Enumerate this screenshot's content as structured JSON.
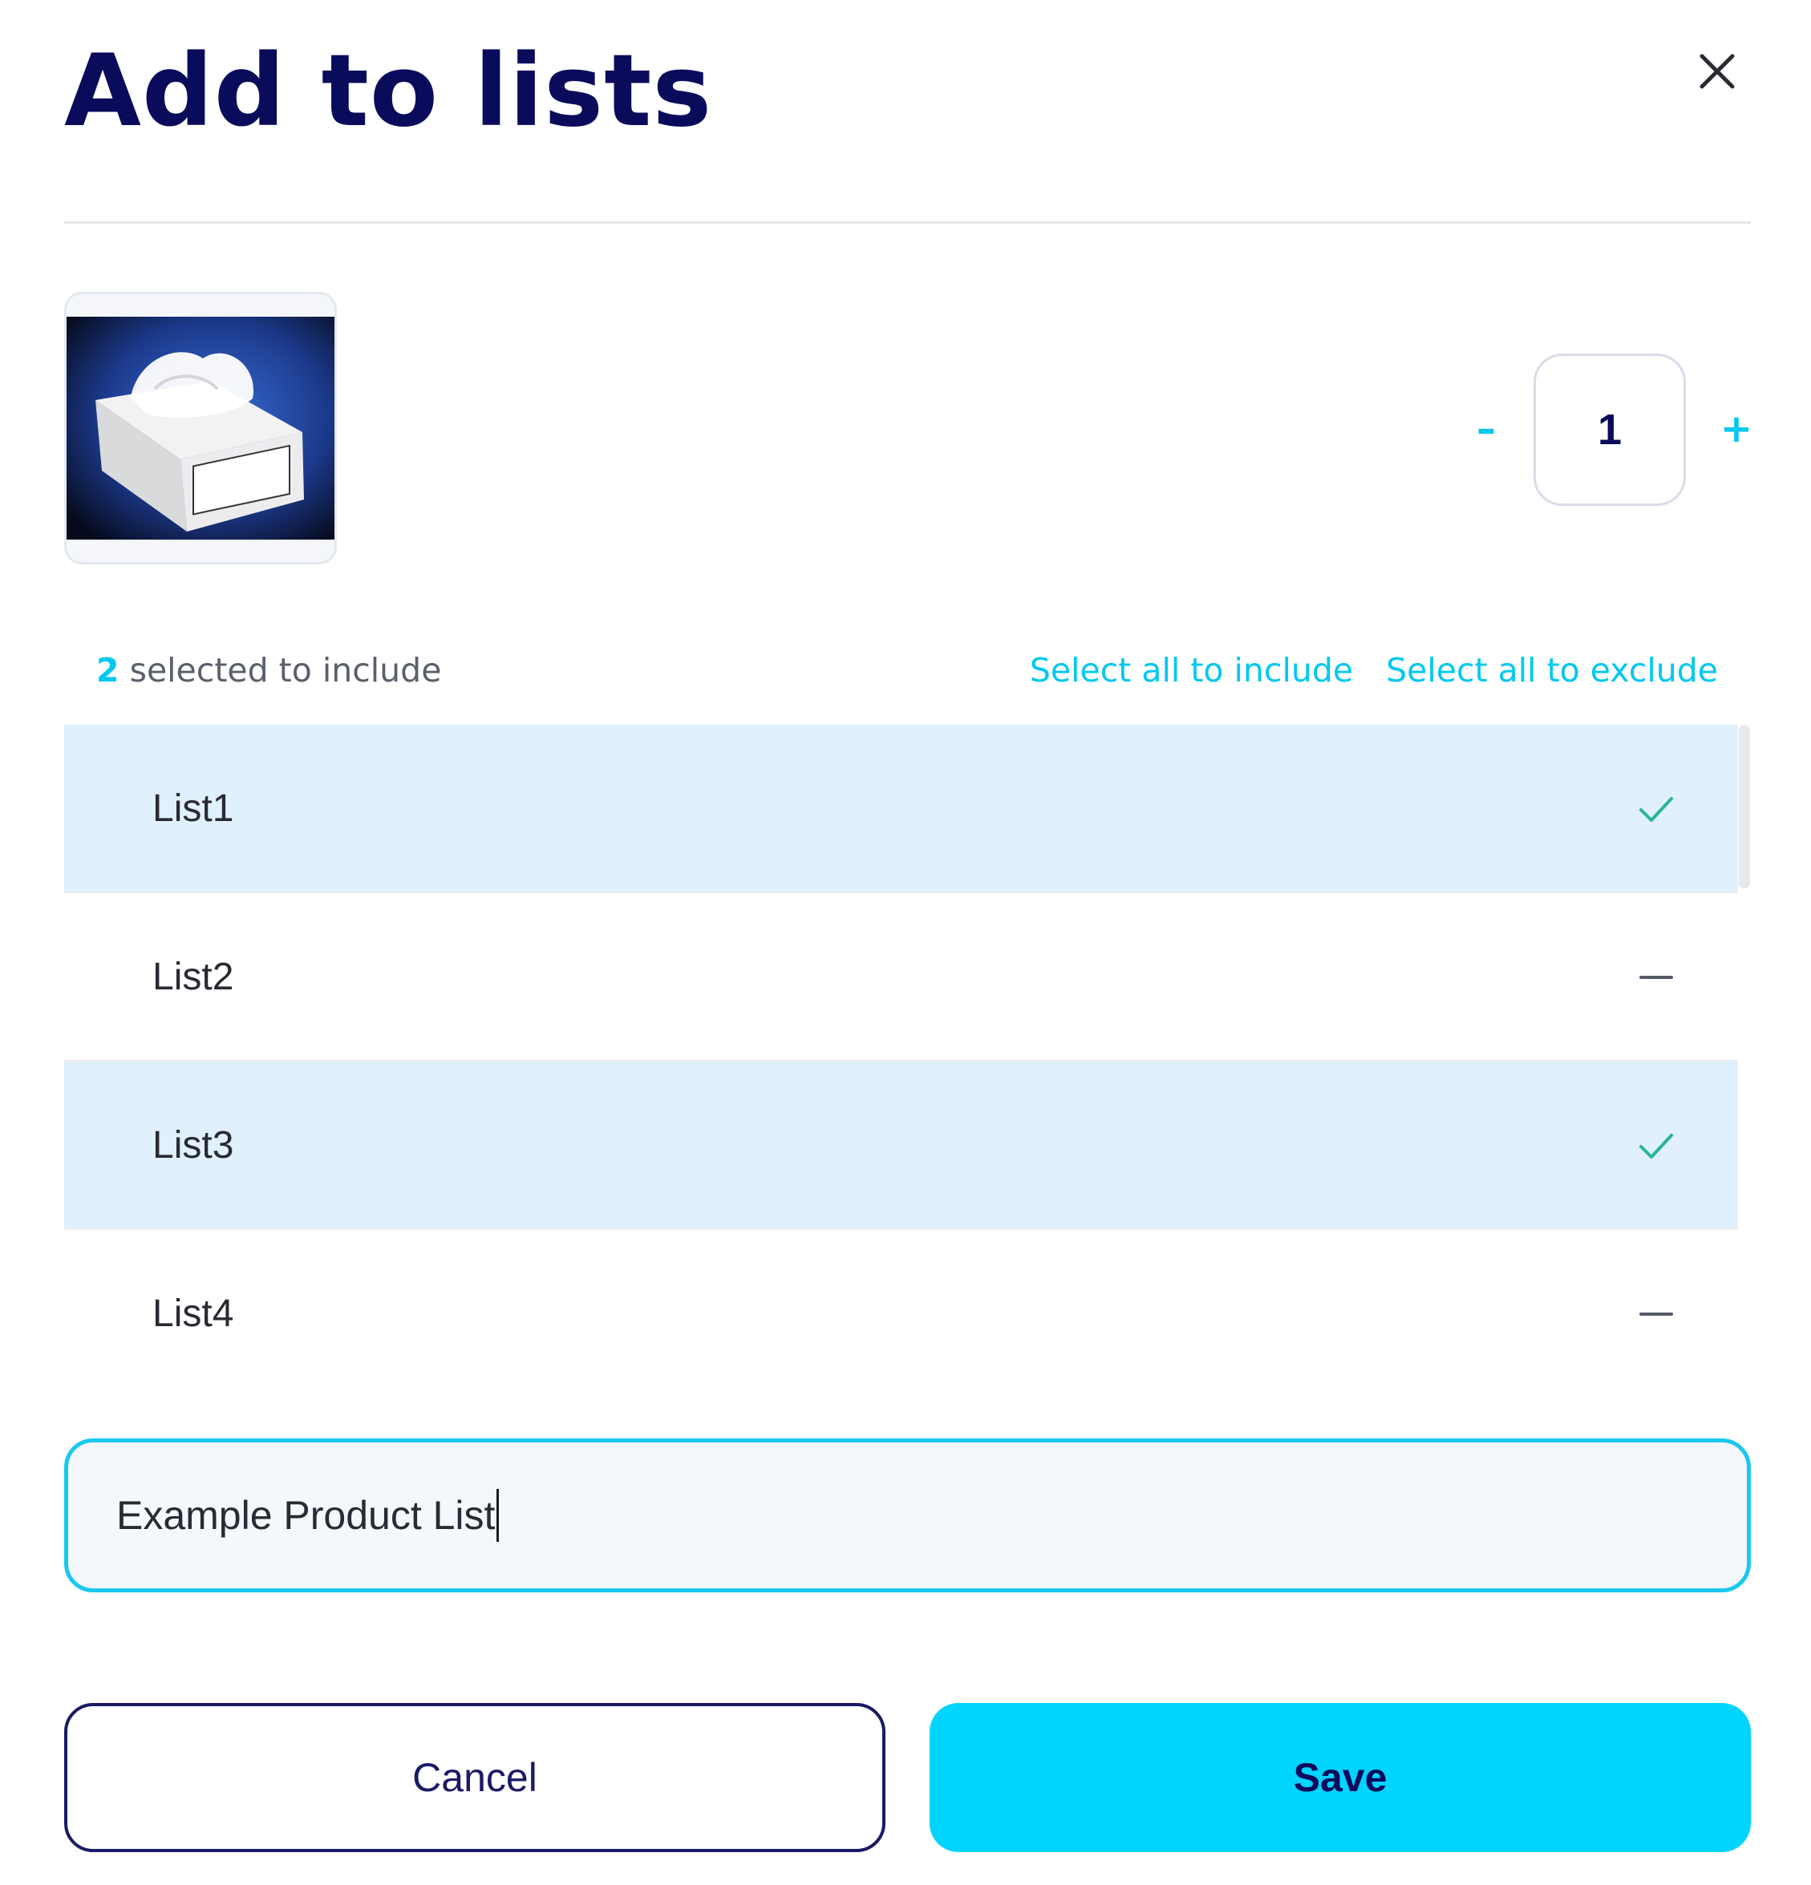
{
  "dialog": {
    "title": "Add to lists",
    "close_icon": "close-icon"
  },
  "product": {
    "image_icon": "product-image"
  },
  "quantity": {
    "decrease_label": "–",
    "value": "1",
    "increase_label": "+"
  },
  "selection": {
    "count": "2",
    "count_text": "selected to include",
    "select_all_include_label": "Select all to include",
    "select_all_exclude_label": "Select all to exclude"
  },
  "lists": [
    {
      "label": "List1",
      "state": "included",
      "icon": "check-icon"
    },
    {
      "label": "List2",
      "state": "not-included",
      "icon": "minus-icon"
    },
    {
      "label": "List3",
      "state": "included",
      "icon": "check-icon"
    },
    {
      "label": "List4",
      "state": "not-included",
      "icon": "minus-icon"
    }
  ],
  "new_list": {
    "value": "Example Product List"
  },
  "actions": {
    "cancel_label": "Cancel",
    "save_label": "Save"
  },
  "colors": {
    "accent": "#00c8f0",
    "title": "#0b0b5c",
    "selected_row": "#e0f0fc",
    "check": "#2bb39a",
    "save_button": "#00d4ff"
  }
}
